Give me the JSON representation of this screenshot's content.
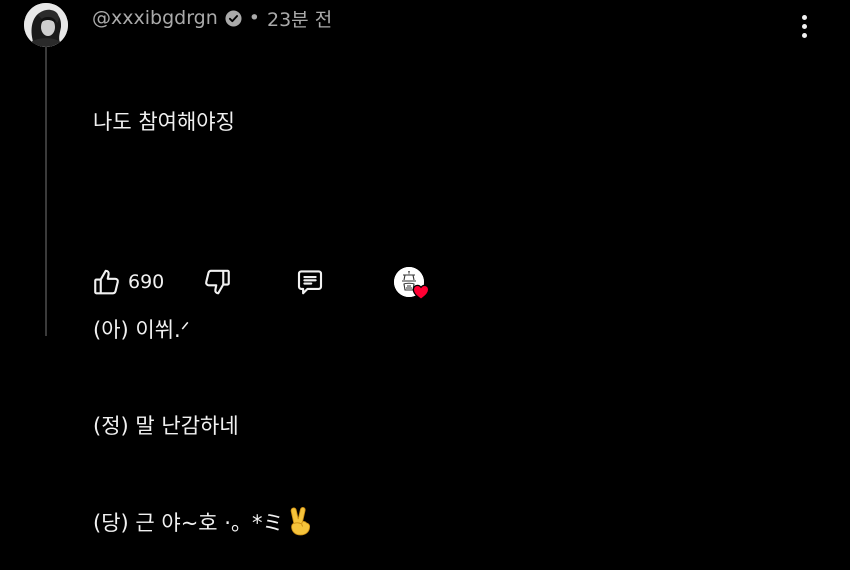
{
  "comment": {
    "author_handle": "@xxxibgdrgn",
    "separator": "•",
    "timestamp": "23분 전",
    "lines": [
      "나도 참여해야징",
      "(아) 이쒸.ᐟ",
      "(정) 말 난감하네",
      "(당) 근 야~호 ·。*ミ"
    ],
    "emoji_icon": "victory-hand-icon"
  },
  "actions": {
    "like_count": "690",
    "icons": {
      "like": "thumbs-up-icon",
      "dislike": "thumbs-down-icon",
      "reply": "comment-reply-icon",
      "more": "more-vertical-icon",
      "verified": "verified-badge-icon",
      "creator_heart": "heart-icon"
    }
  },
  "colors": {
    "background": "#000000",
    "text_primary": "#f1f1f1",
    "text_secondary": "#aaaaaa",
    "heart": "#ff0033",
    "thread_line": "#3a3a3a"
  }
}
